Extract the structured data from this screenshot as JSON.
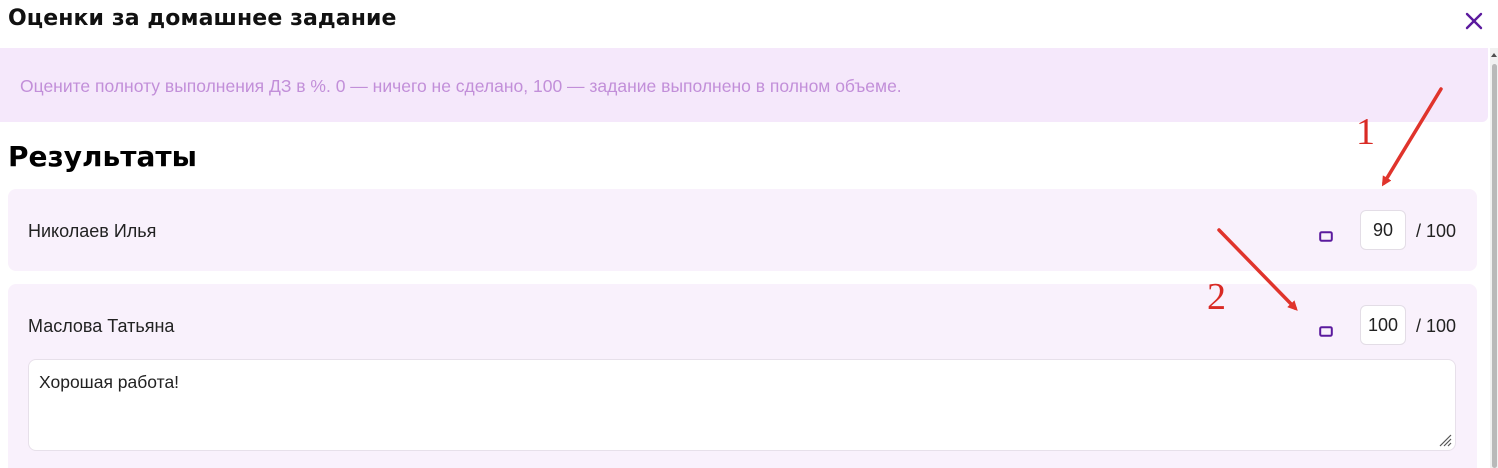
{
  "dialog": {
    "title": "Оценки за домашнее задание",
    "close_icon": "close-icon"
  },
  "banner": {
    "text": "Оцените полноту выполнения ДЗ в %. 0 — ничего не сделано, 100 — задание выполнено в полном объеме."
  },
  "results": {
    "title": "Результаты",
    "students": [
      {
        "name": "Николаев Илья",
        "score": "90",
        "max_label": "/ 100",
        "comment_icon": "comment-icon"
      },
      {
        "name": "Маслова Татьяна",
        "score": "100",
        "max_label": "/ 100",
        "comment_icon": "comment-icon",
        "comment": "Хорошая работа!"
      }
    ]
  },
  "annotations": {
    "marker_1": "1",
    "marker_2": "2",
    "color": "#d92a24"
  },
  "colors": {
    "accent": "#6a1fb0",
    "banner_bg": "#f5e8fb",
    "banner_text": "#c28fd9",
    "card_bg": "#f9f1fc"
  }
}
